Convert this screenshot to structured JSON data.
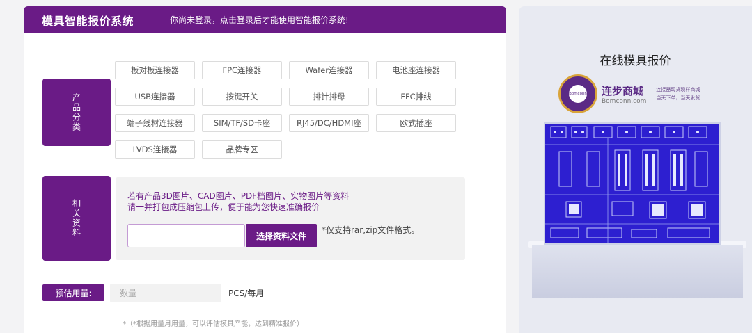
{
  "header": {
    "title": "模具智能报价系统",
    "login_message": "你尚未登录，点击登录后才能使用智能报价系统!"
  },
  "product_category": {
    "label": "产品分类",
    "items": [
      "板对板连接器",
      "FPC连接器",
      "Wafer连接器",
      "电池座连接器",
      "USB连接器",
      "按键开关",
      "排针排母",
      "FFC排线",
      "端子线材连接器",
      "SIM/TF/SD卡座",
      "RJ45/DC/HDMI座",
      "欧式插座",
      "LVDS连接器",
      "品牌专区"
    ]
  },
  "documents": {
    "label": "相关资料",
    "instruction_line1": "若有产品3D图片、CAD图片、PDF档图片、实物图片等资料",
    "instruction_line2": "请一并打包成压缩包上传，便于能为您快速准确报价",
    "choose_file_label": "选择资料文件",
    "format_note": "*仅支持rar,zip文件格式。"
  },
  "usage": {
    "label": "预估用量:",
    "placeholder": "数量",
    "unit": "PCS/每月",
    "note": "*（*根据用量月用量，可以评估模具产能，达到精准报价）"
  },
  "promo": {
    "title": "在线模具报价",
    "brand_name": "连步商城",
    "brand_url": "Bomconn.com",
    "logo_text": "Bomconn",
    "tagline_line1": "连接器现货现样商城",
    "tagline_line2": "当天下单，当天发货"
  },
  "colors": {
    "brand_purple": "#6a1b86",
    "pcb_blue": "#2d1fd0"
  }
}
